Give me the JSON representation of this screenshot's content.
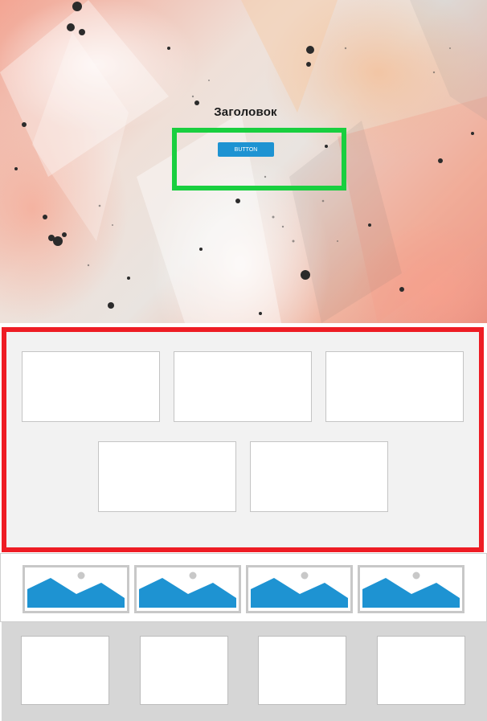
{
  "hero": {
    "title": "Заголовок",
    "button_label": "BUTTON"
  },
  "colors": {
    "accent_button": "#1e93d2",
    "green_outline": "#19cf3f",
    "red_outline": "#ee1c24",
    "section_gray": "#d6d6d6",
    "panel_gray": "#f2f2f2"
  },
  "icons": [
    "image-placeholder-icon"
  ]
}
